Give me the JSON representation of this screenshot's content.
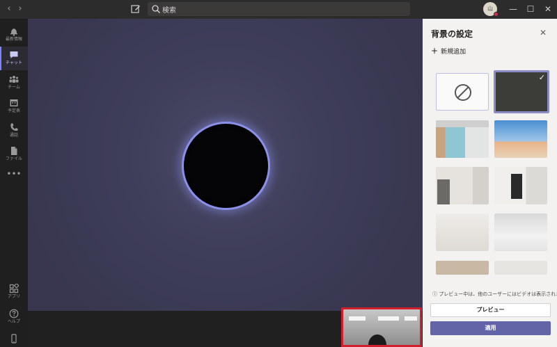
{
  "titlebar": {
    "back_glyph": "‹",
    "forward_glyph": "›",
    "search_placeholder": "検索",
    "avatar_initials": "山",
    "minimize_glyph": "—",
    "maximize_glyph": "☐",
    "close_glyph": "✕"
  },
  "rail": {
    "items": [
      {
        "label": "最新情報",
        "icon": "bell-icon"
      },
      {
        "label": "チャット",
        "icon": "chat-icon"
      },
      {
        "label": "チーム",
        "icon": "teams-icon"
      },
      {
        "label": "予定表",
        "icon": "calendar-icon"
      },
      {
        "label": "通話",
        "icon": "phone-icon"
      },
      {
        "label": "ファイル",
        "icon": "file-icon"
      }
    ],
    "more_glyph": "•••",
    "bottom_items": [
      {
        "label": "アプリ",
        "icon": "apps-icon"
      },
      {
        "label": "ヘルプ",
        "icon": "help-icon"
      }
    ],
    "active_index": 1
  },
  "panel": {
    "title": "背景の設定",
    "close_glyph": "✕",
    "add_new_label": "新規追加",
    "add_new_glyph": "+",
    "none_tile_glyph": "⊘",
    "check_glyph": "✓",
    "notice": "プレビュー中は、他のユーザーにはビデオは表示されま...",
    "notice_icon_glyph": "ⓘ",
    "preview_button": "プレビュー",
    "apply_button": "適用"
  },
  "colors": {
    "accent": "#6264a7",
    "highlight_frame": "#d11f2d",
    "glow_ring": "#8a8fe8"
  }
}
